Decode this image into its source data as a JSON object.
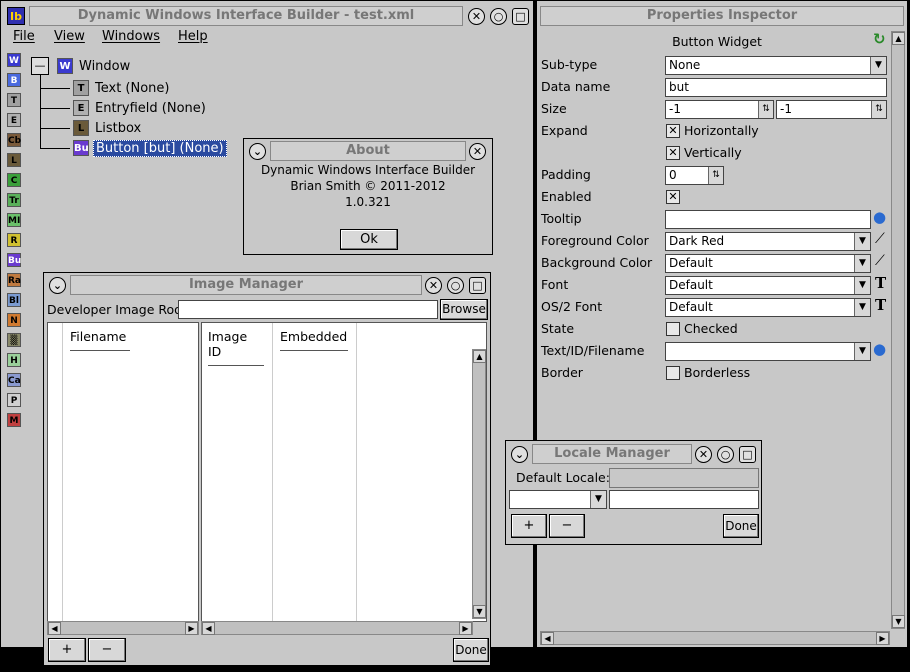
{
  "main_window": {
    "title": "Dynamic Windows Interface Builder - test.xml",
    "app_icon": "Ib",
    "menu": [
      "File",
      "View",
      "Windows",
      "Help"
    ],
    "palette": [
      {
        "code": "W",
        "color": "#3a3acf",
        "fg": "#fff"
      },
      {
        "code": "B",
        "color": "#4a6adf",
        "fg": "#fff"
      },
      {
        "code": "T",
        "color": "#a0a0a0",
        "fg": "#000"
      },
      {
        "code": "E",
        "color": "#b0b0b0",
        "fg": "#000"
      },
      {
        "code": "Cb",
        "color": "#7a5a3a",
        "fg": "#000"
      },
      {
        "code": "L",
        "color": "#6a5a3a",
        "fg": "#000"
      },
      {
        "code": "C",
        "color": "#3aa03a",
        "fg": "#000"
      },
      {
        "code": "Tr",
        "color": "#5ab05a",
        "fg": "#000"
      },
      {
        "code": "MI",
        "color": "#6ac06a",
        "fg": "#000"
      },
      {
        "code": "R",
        "color": "#d0c030",
        "fg": "#000"
      },
      {
        "code": "Bu",
        "color": "#6a3acf",
        "fg": "#fff"
      },
      {
        "code": "Ra",
        "color": "#c07a40",
        "fg": "#000"
      },
      {
        "code": "Bl",
        "color": "#7a9ad0",
        "fg": "#000"
      },
      {
        "code": "N",
        "color": "#d07a30",
        "fg": "#000"
      },
      {
        "code": "▒",
        "color": "#8a8a6a",
        "fg": "#000"
      },
      {
        "code": "H",
        "color": "#9ad09a",
        "fg": "#000"
      },
      {
        "code": "Ca",
        "color": "#8a9ad0",
        "fg": "#000"
      },
      {
        "code": "P",
        "color": "#d0d0d0",
        "fg": "#000"
      },
      {
        "code": "M",
        "color": "#c04040",
        "fg": "#000"
      }
    ],
    "tree": {
      "expander": "—",
      "root": {
        "icon": "W",
        "label": "Window"
      },
      "children": [
        {
          "icon": "T",
          "label": "Text (None)"
        },
        {
          "icon": "E",
          "label": "Entryfield (None)"
        },
        {
          "icon": "L",
          "label": "Listbox"
        },
        {
          "icon": "Bu",
          "label": "Button [but] (None)"
        }
      ]
    }
  },
  "about": {
    "title": "About",
    "line1": "Dynamic Windows Interface Builder",
    "line2": "Brian Smith © 2011-2012",
    "line3": "1.0.321",
    "ok": "Ok"
  },
  "image_manager": {
    "title": "Image Manager",
    "root_label": "Developer Image Root:",
    "root_value": "",
    "browse": "Browse",
    "columns": [
      "Filename",
      "Image ID",
      "Embedded"
    ],
    "add": "+",
    "remove": "−",
    "done": "Done"
  },
  "properties": {
    "title": "Properties Inspector",
    "header": "Button Widget",
    "subtype_label": "Sub-type",
    "subtype_value": "None",
    "dataname_label": "Data name",
    "dataname_value": "but",
    "size_label": "Size",
    "size_w": "-1",
    "size_h": "-1",
    "expand_label": "Expand",
    "expand_h": "Horizontally",
    "expand_v": "Vertically",
    "padding_label": "Padding",
    "padding_value": "0",
    "enabled_label": "Enabled",
    "tooltip_label": "Tooltip",
    "tooltip_value": "",
    "fg_label": "Foreground Color",
    "fg_value": "Dark Red",
    "bg_label": "Background Color",
    "bg_value": "Default",
    "font_label": "Font",
    "font_value": "Default",
    "os2font_label": "OS/2 Font",
    "os2font_value": "Default",
    "state_label": "State",
    "state_value": "Checked",
    "textid_label": "Text/ID/Filename",
    "textid_value": "",
    "border_label": "Border",
    "border_value": "Borderless",
    "check_mark": "✕"
  },
  "locale": {
    "title": "Locale Manager",
    "default_label": "Default Locale:",
    "add": "+",
    "remove": "−",
    "done": "Done"
  },
  "icons": {
    "close": "✕",
    "minimize": "○",
    "maximize": "□",
    "menu": "⌄",
    "arrow_down": "▼",
    "arrow_up": "▲",
    "arrow_left": "◀",
    "arrow_right": "▶",
    "spin": "⇅",
    "globe": "●",
    "brush": "⟋",
    "font": "T",
    "refresh": "↻"
  }
}
